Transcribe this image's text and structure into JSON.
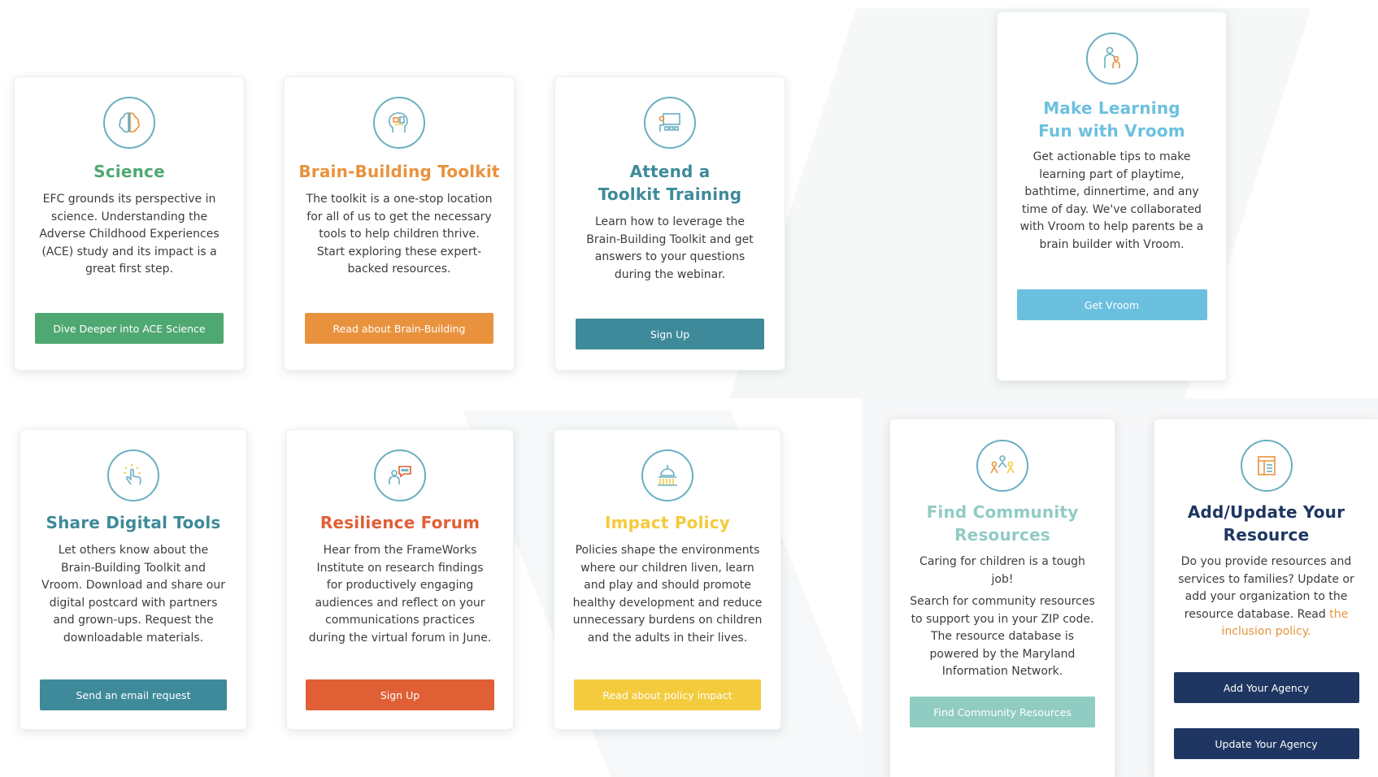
{
  "colors": {
    "green": "#4fa872",
    "orange": "#e9923d",
    "teal": "#3e8a9a",
    "sky": "#6cc0df",
    "red_orange": "#e05f35",
    "yellow": "#f3cb3d",
    "mint": "#91ccc3",
    "navy": "#1e3661"
  },
  "cards": {
    "science": {
      "icon": "brain-icon",
      "title": "Science",
      "body": "EFC grounds its perspective in science. Understanding the Adverse Childhood Experiences (ACE) study and its impact is a great first step.",
      "button": "Dive Deeper into ACE Science"
    },
    "toolkit": {
      "icon": "toolkit-head-icon",
      "title": "Brain-Building Toolkit",
      "body": "The toolkit is a one-stop location for all of us to get the necessary tools to help children thrive. Start exploring these expert-backed resources.",
      "button": "Read about Brain-Building"
    },
    "training": {
      "icon": "presentation-icon",
      "title": "Attend a Toolkit Training",
      "body": "Learn how to leverage the Brain-Building Toolkit and get answers to your questions during the webinar.",
      "button": "Sign Up"
    },
    "vroom": {
      "icon": "parent-child-icon",
      "title": "Make Learning Fun with Vroom",
      "body": "Get actionable tips to make learning part of playtime, bathtime, dinnertime, and any time of day. We've collaborated with Vroom to help parents be a brain builder with Vroom.",
      "button": "Get Vroom"
    },
    "share": {
      "icon": "touch-icon",
      "title": "Share Digital Tools",
      "body": "Let others know about the Brain-Building Toolkit and Vroom. Download and share our digital postcard with partners and grown-ups. Request the downloadable materials.",
      "button": "Send an email request"
    },
    "forum": {
      "icon": "discussion-icon",
      "title": "Resilience Forum",
      "body": "Hear from the FrameWorks Institute on research findings for productively engaging audiences and reflect on your communications practices during the virtual forum in June.",
      "button": "Sign Up"
    },
    "policy": {
      "icon": "capitol-icon",
      "title": "Impact Policy",
      "body": "Policies shape the environments where our children liven, learn and play and should promote healthy development and reduce unnecessary burdens on children and the adults in their lives.",
      "button": "Read about policy impact"
    },
    "community": {
      "icon": "community-people-icon",
      "title": "Find Community Resources",
      "body_1": "Caring for children is a tough job!",
      "body_2": "Search for community resources to support you in your ZIP code. The resource database is powered by the Maryland Information Network.",
      "button": "Find Community Resources"
    },
    "agency": {
      "icon": "document-list-icon",
      "title": "Add/Update Your Resource",
      "body": "Do you provide resources and services to families? Update or add your organization to the resource database. Read",
      "link": "the inclusion policy.",
      "button_add": "Add Your Agency",
      "button_update": "Update Your Agency"
    }
  }
}
